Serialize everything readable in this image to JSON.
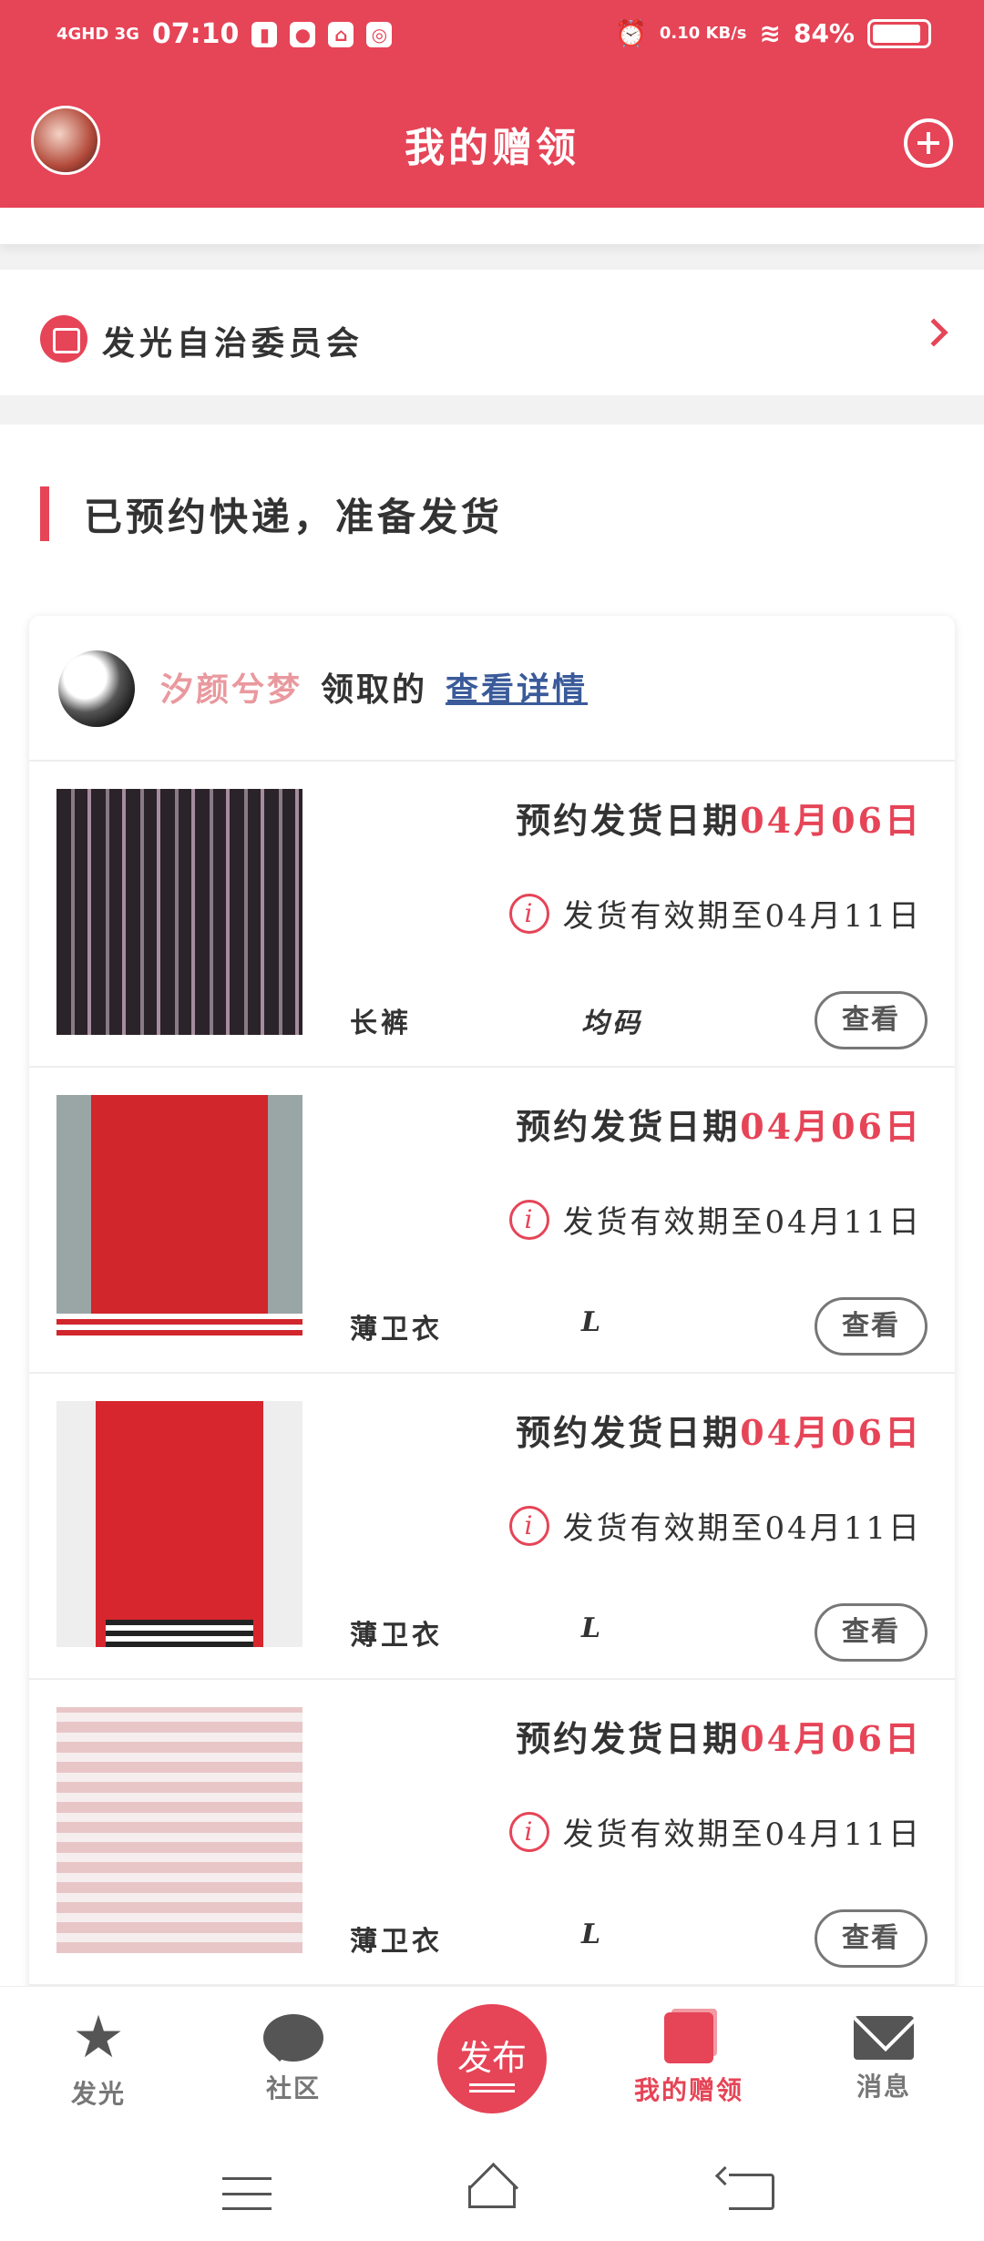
{
  "status_bar": {
    "network": "4GHD 3G",
    "time": "07:10",
    "speed": "0.10 KB/s",
    "battery": "84%"
  },
  "header": {
    "title": "我的赠领"
  },
  "org": {
    "name": "发光自治委员会"
  },
  "section": {
    "title": "已预约快递，准备发货"
  },
  "card": {
    "user_name": "汐颜兮梦",
    "claim_text": "领取的",
    "detail_link": "查看详情"
  },
  "items": [
    {
      "ship_label": "预约发货日期",
      "ship_date": "04月06日",
      "valid": "发货有效期至04月11日",
      "name": "长裤",
      "size": "均码",
      "view": "查看"
    },
    {
      "ship_label": "预约发货日期",
      "ship_date": "04月06日",
      "valid": "发货有效期至04月11日",
      "name": "薄卫衣",
      "size": "L",
      "view": "查看"
    },
    {
      "ship_label": "预约发货日期",
      "ship_date": "04月06日",
      "valid": "发货有效期至04月11日",
      "name": "薄卫衣",
      "size": "L",
      "view": "查看"
    },
    {
      "ship_label": "预约发货日期",
      "ship_date": "04月06日",
      "valid": "发货有效期至04月11日",
      "name": "薄卫衣",
      "size": "L",
      "view": "查看"
    }
  ],
  "tabbar": {
    "tabs": [
      {
        "label": "发光",
        "icon": "star-icon"
      },
      {
        "label": "社区",
        "icon": "chat-icon"
      },
      {
        "label": "发布",
        "icon": "publish-icon"
      },
      {
        "label": "我的赠领",
        "icon": "book-icon"
      },
      {
        "label": "消息",
        "icon": "mail-icon"
      }
    ]
  },
  "colors": {
    "accent": "#e64457",
    "link": "#3a5a9a",
    "username": "#e9999e"
  }
}
